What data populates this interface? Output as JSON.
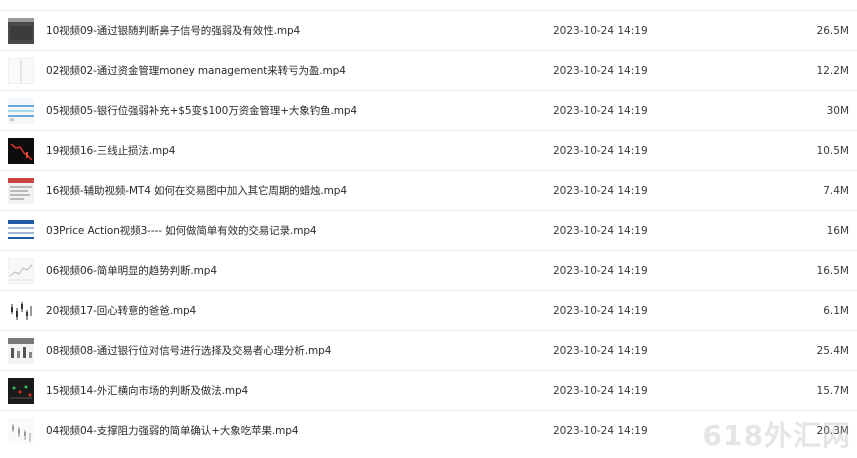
{
  "files": [
    {
      "name": "10视频09-通过银随判断鼻子信号的强弱及有效性.mp4",
      "date": "2023-10-24 14:19",
      "size": "26.5M",
      "thumb": "dark-gray"
    },
    {
      "name": "02视频02-通过资金管理money management来转亏为盈.mp4",
      "date": "2023-10-24 14:19",
      "size": "12.2M",
      "thumb": "white-line"
    },
    {
      "name": "05视频05-银行位强弱补充+$5变$100万资金管理+大象钓鱼.mp4",
      "date": "2023-10-24 14:19",
      "size": "30M",
      "thumb": "blue-lines"
    },
    {
      "name": "19视频16-三线止损法.mp4",
      "date": "2023-10-24 14:19",
      "size": "10.5M",
      "thumb": "black-red"
    },
    {
      "name": "16视频-辅助视频-MT4 如何在交易图中加入其它周期的蜡烛.mp4",
      "date": "2023-10-24 14:19",
      "size": "7.4M",
      "thumb": "red-menu"
    },
    {
      "name": "03Price Action视频3---- 如何做简单有效的交易记录.mp4",
      "date": "2023-10-24 14:19",
      "size": "16M",
      "thumb": "blue-table"
    },
    {
      "name": "06视频06-简单明显的趋势判断.mp4",
      "date": "2023-10-24 14:19",
      "size": "16.5M",
      "thumb": "light-chart"
    },
    {
      "name": "20视频17-回心转意的爸爸.mp4",
      "date": "2023-10-24 14:19",
      "size": "6.1M",
      "thumb": "candles"
    },
    {
      "name": "08视频08-通过银行位对信号进行选择及交易者心理分析.mp4",
      "date": "2023-10-24 14:19",
      "size": "25.4M",
      "thumb": "gray-bars"
    },
    {
      "name": "15视频14-外汇横向市场的判断及做法.mp4",
      "date": "2023-10-24 14:19",
      "size": "15.7M",
      "thumb": "dark-dots"
    },
    {
      "name": "04视频04-支撑阻力强弱的简单确认+大象吃苹果.mp4",
      "date": "2023-10-24 14:19",
      "size": "20.3M",
      "thumb": "light-candles"
    }
  ],
  "watermark": "618外汇网"
}
